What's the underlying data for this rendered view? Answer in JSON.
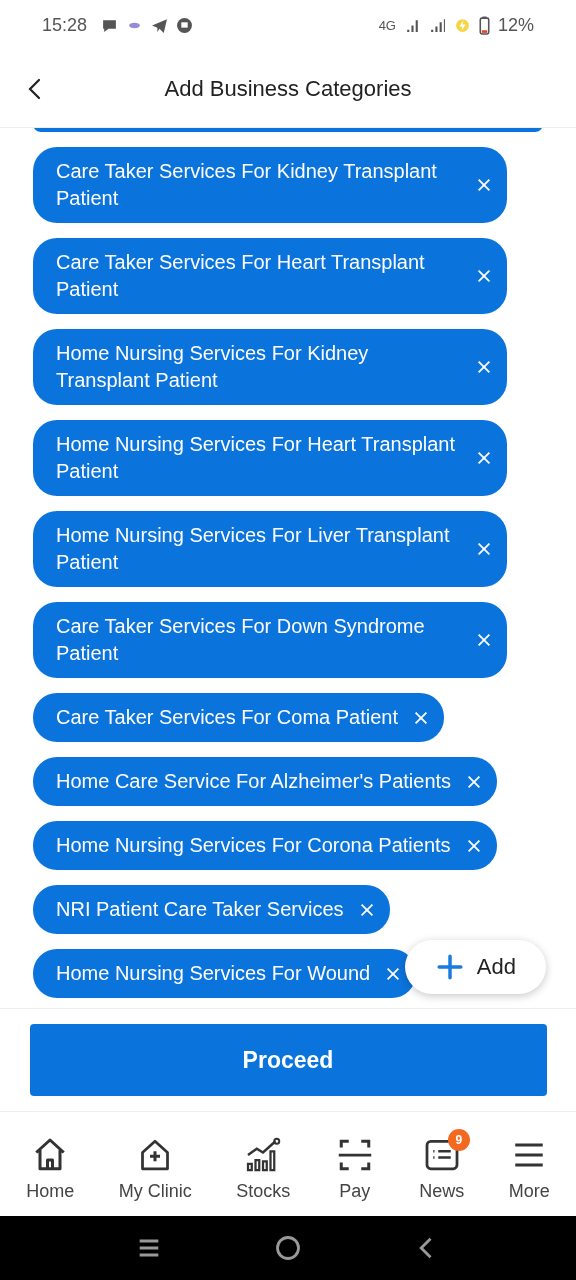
{
  "status_bar": {
    "time": "15:28",
    "network": "4G",
    "battery": "12%"
  },
  "header": {
    "title": "Add Business Categories"
  },
  "categories": [
    {
      "label": "Care Taker Services For Kidney Transplant Patient"
    },
    {
      "label": "Care Taker Services For Heart Transplant Patient"
    },
    {
      "label": "Home Nursing Services For Kidney Transplant Patient"
    },
    {
      "label": "Home Nursing Services For Heart Transplant Patient"
    },
    {
      "label": "Home Nursing Services For Liver Transplant Patient"
    },
    {
      "label": "Care Taker Services For Down Syndrome Patient"
    },
    {
      "label": "Care Taker Services For Coma Patient"
    },
    {
      "label": "Home Care Service For Alzheimer's Patients"
    },
    {
      "label": "Home Nursing Services For Corona Patients"
    },
    {
      "label": "NRI Patient Care Taker Services"
    },
    {
      "label": "Home Nursing Services For Wound"
    }
  ],
  "add_button": {
    "label": "Add"
  },
  "proceed_button": {
    "label": "Proceed"
  },
  "bottom_nav": [
    {
      "kind": "home",
      "label": "Home",
      "selected": false
    },
    {
      "kind": "clinic",
      "label": "My Clinic",
      "selected": false
    },
    {
      "kind": "stocks",
      "label": "Stocks",
      "selected": false
    },
    {
      "kind": "pay",
      "label": "Pay",
      "selected": false
    },
    {
      "kind": "news",
      "label": "News",
      "badge": "9",
      "selected": false
    },
    {
      "kind": "more",
      "label": "More",
      "selected": false
    }
  ]
}
